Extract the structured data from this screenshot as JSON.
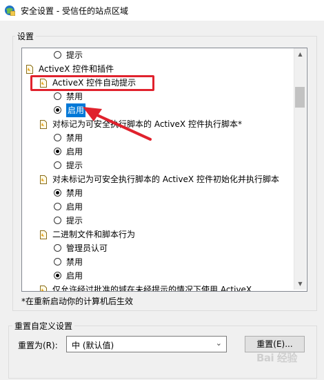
{
  "window": {
    "title": "安全设置 - 受信任的站点区域"
  },
  "settings_group": {
    "label": "设置"
  },
  "tree": {
    "rows": [
      {
        "kind": "radio",
        "label": "提示",
        "checked": false
      },
      {
        "kind": "category",
        "label": "ActiveX 控件和插件"
      },
      {
        "kind": "setting",
        "label": "ActiveX 控件自动提示"
      },
      {
        "kind": "radio",
        "label": "禁用",
        "checked": false
      },
      {
        "kind": "radio",
        "label": "启用",
        "checked": true,
        "selected": true
      },
      {
        "kind": "setting",
        "label": "对标记为可安全执行脚本的 ActiveX 控件执行脚本*"
      },
      {
        "kind": "radio",
        "label": "禁用",
        "checked": false
      },
      {
        "kind": "radio",
        "label": "启用",
        "checked": true
      },
      {
        "kind": "radio",
        "label": "提示",
        "checked": false
      },
      {
        "kind": "setting",
        "label": "对未标记为可安全执行脚本的 ActiveX 控件初始化并执行脚本"
      },
      {
        "kind": "radio",
        "label": "禁用",
        "checked": true
      },
      {
        "kind": "radio",
        "label": "启用",
        "checked": false
      },
      {
        "kind": "radio",
        "label": "提示",
        "checked": false
      },
      {
        "kind": "setting",
        "label": "二进制文件和脚本行为"
      },
      {
        "kind": "radio",
        "label": "管理员认可",
        "checked": false
      },
      {
        "kind": "radio",
        "label": "禁用",
        "checked": false
      },
      {
        "kind": "radio",
        "label": "启用",
        "checked": true
      },
      {
        "kind": "setting",
        "label": "仅允许经过批准的域在未经提示的情况下使用 ActiveX"
      }
    ]
  },
  "note": "*在重新启动你的计算机后生效",
  "reset_group": {
    "label": "重置自定义设置",
    "field_label": "重置为(R):",
    "select_value": "中 (默认值)",
    "button_label": "重置(E)..."
  },
  "watermark": "Bai 经验",
  "colors": {
    "selection": "#0078d7",
    "annotation_red": "#e0222d"
  }
}
